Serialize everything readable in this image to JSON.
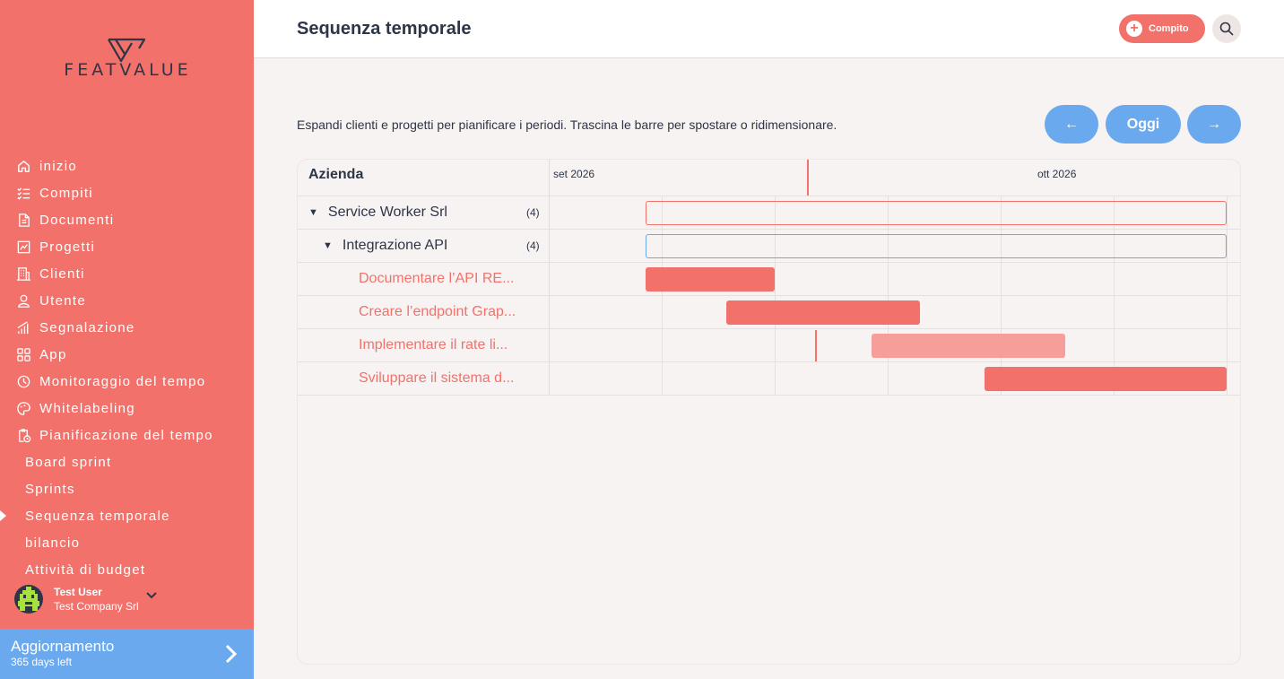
{
  "brand": {
    "name": "FEATVALUE",
    "primary": "#f3716b",
    "accent": "#6aa9ee",
    "dark": "#2d3547"
  },
  "sidebar": {
    "items": [
      {
        "label": "inizio",
        "icon": "home-icon"
      },
      {
        "label": "Compiti",
        "icon": "checklist-icon"
      },
      {
        "label": "Documenti",
        "icon": "document-icon"
      },
      {
        "label": "Progetti",
        "icon": "chart-icon"
      },
      {
        "label": "Clienti",
        "icon": "building-icon"
      },
      {
        "label": "Utente",
        "icon": "user-icon"
      },
      {
        "label": "Segnalazione",
        "icon": "bars-icon"
      },
      {
        "label": "App",
        "icon": "apps-icon"
      },
      {
        "label": "Monitoraggio del tempo",
        "icon": "timer-icon"
      },
      {
        "label": "Whitelabeling",
        "icon": "palette-icon"
      },
      {
        "label": "Pianificazione del tempo",
        "icon": "clipboard-clock-icon"
      }
    ],
    "subitems": [
      {
        "label": "Board sprint"
      },
      {
        "label": "Sprints"
      },
      {
        "label": "Sequenza temporale",
        "active": true
      },
      {
        "label": "bilancio"
      },
      {
        "label": "Attività di budget"
      }
    ],
    "user": {
      "name": "Test User",
      "company": "Test Company Srl"
    },
    "upgrade": {
      "title": "Aggiornamento",
      "subtitle": "365 days left"
    }
  },
  "header": {
    "title": "Sequenza temporale",
    "task_button": "Compito"
  },
  "main": {
    "description": "Espandi clienti e progetti per pianificare i periodi. Trascina le barre per spostare o ridimensionare.",
    "nav": {
      "prev": "←",
      "today": "Oggi",
      "next": "→"
    }
  },
  "gantt": {
    "column_title": "Azienda",
    "months": [
      "set 2026",
      "ott 2026"
    ],
    "client": {
      "name": "Service Worker Srl",
      "count": "(4)"
    },
    "project": {
      "name": "Integrazione API",
      "count": "(4)"
    },
    "tasks": [
      {
        "name": "Documentare l’API RE...",
        "state": "normal"
      },
      {
        "name": "Creare l’endpoint Grap...",
        "state": "normal"
      },
      {
        "name": "Implementare il rate li...",
        "state": "light"
      },
      {
        "name": "Sviluppare il sistema d...",
        "state": "normal"
      }
    ]
  }
}
